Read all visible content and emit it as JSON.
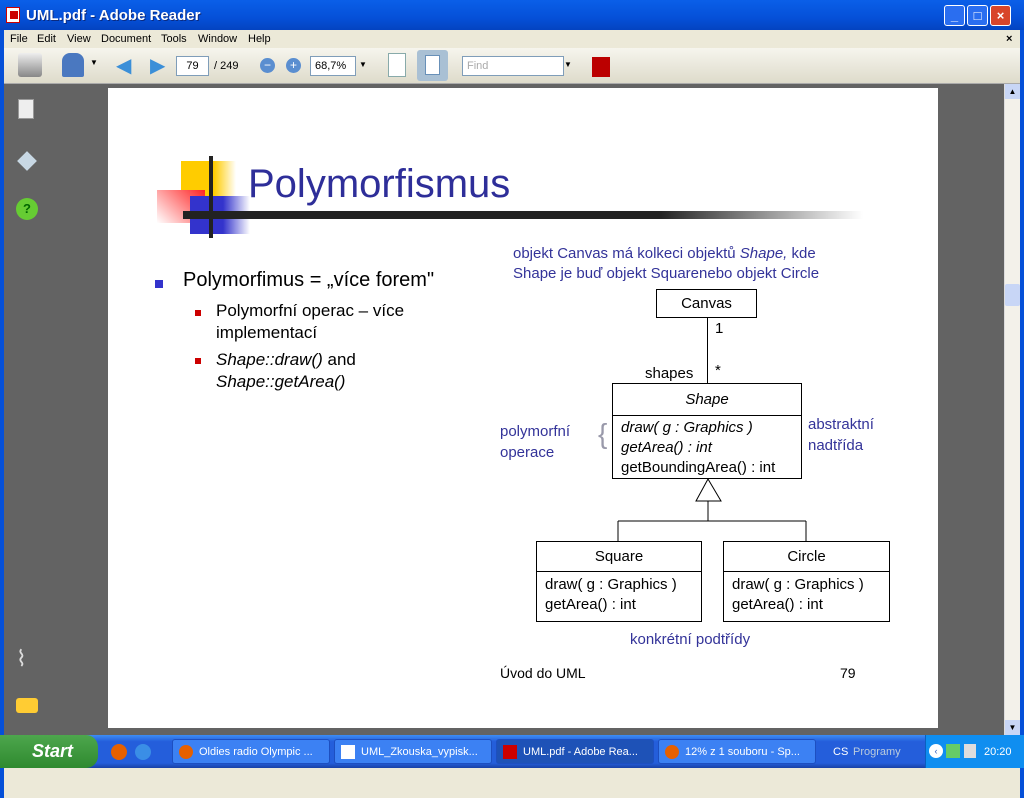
{
  "window": {
    "title": "UML.pdf - Adobe Reader"
  },
  "menu": [
    "File",
    "Edit",
    "View",
    "Document",
    "Tools",
    "Window",
    "Help"
  ],
  "toolbar": {
    "page_current": "79",
    "page_total": "/ 249",
    "zoom": "68,7%",
    "find_placeholder": "Find"
  },
  "slide": {
    "title": "Polymorfismus",
    "bullet": "Polymorfimus = „více forem\"",
    "sub_bullets": [
      "Polymorfní operac – více implementací"
    ],
    "sub_bullet2_a": "Shape::draw()",
    "sub_bullet2_and": " and",
    "sub_bullet2_b": "Shape::getArea()",
    "note_line1_a": "objekt Canvas má kolkeci objektů ",
    "note_line1_b": "Shape,",
    "note_line1_c": " kde",
    "note_line2": "Shape je buď  objekt Squarenebo objekt  Circle",
    "canvas": "Canvas",
    "mult_one": "1",
    "role": "shapes",
    "mult_many": "*",
    "shape": {
      "name": "Shape",
      "ops": [
        "draw( g : Graphics )",
        "getArea() : int"
      ],
      "op3": "getBoundingArea() : int"
    },
    "poly_label": [
      "polymorfní",
      "operace"
    ],
    "abstract_label": [
      "abstraktní",
      "nadtřída"
    ],
    "square": {
      "name": "Square",
      "ops": [
        "draw( g : Graphics )",
        "getArea() : int"
      ]
    },
    "circle": {
      "name": "Circle",
      "ops": [
        "draw( g : Graphics )",
        "getArea() : int"
      ]
    },
    "concrete_label": "konkrétní podtřídy",
    "footer_left": "Úvod do UML",
    "footer_page": "79"
  },
  "taskbar": {
    "start": "Start",
    "tasks": [
      "Oldies radio Olympic ...",
      "UML_Zkouska_vypisk...",
      "UML.pdf - Adobe Rea...",
      "12% z 1 souboru - Sp..."
    ],
    "lang": "CS",
    "programs": "Programy",
    "clock": "20:20"
  }
}
